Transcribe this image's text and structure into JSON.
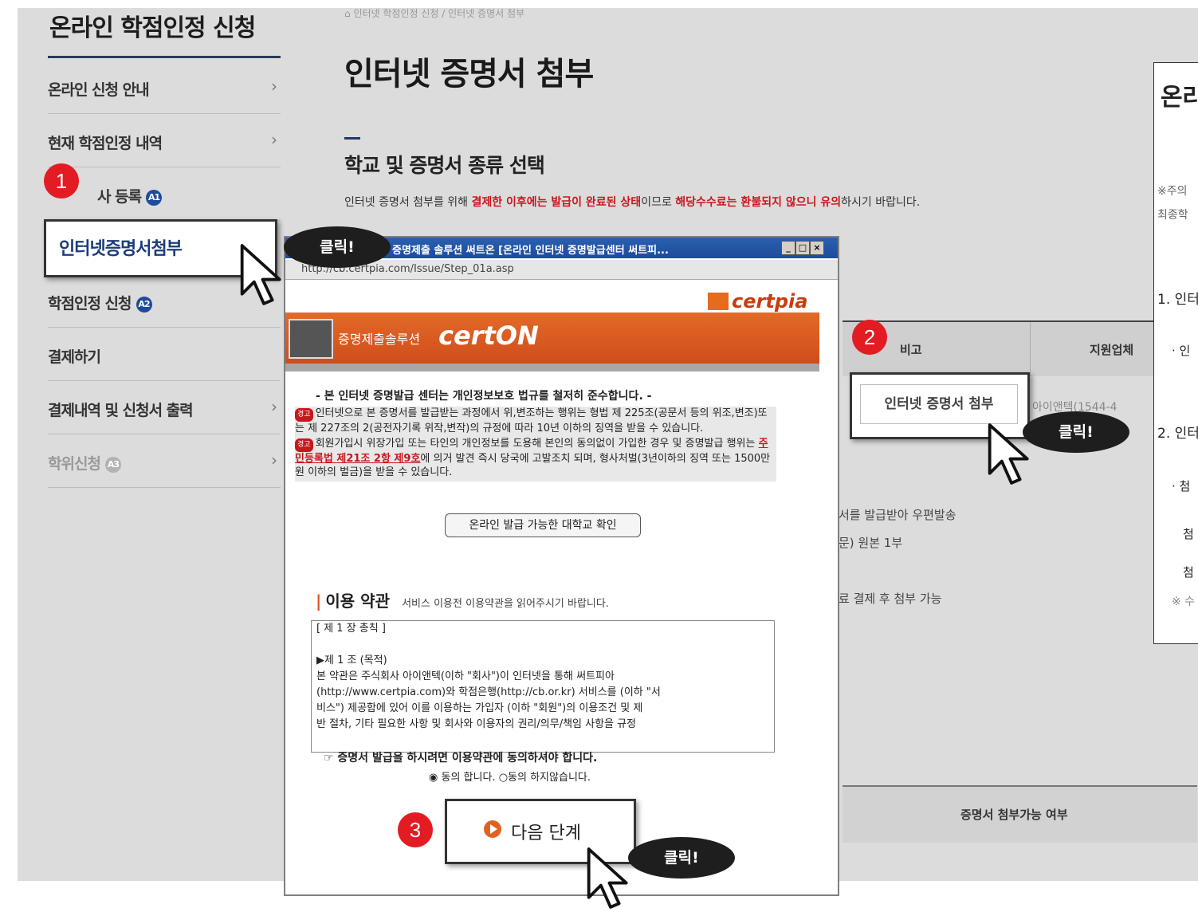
{
  "left_title": "온라인 학점인정 신청",
  "breadcrumb": "인터넷 학점인정 신청 / 인터넷 증명서 첨부",
  "nav": [
    {
      "label": "온라인 신청 안내"
    },
    {
      "label": "현재 학점인정 내역"
    },
    {
      "label": "사 등록",
      "badge": "A1"
    },
    {
      "label": "인터넷증명서첨부"
    },
    {
      "label": "학점인정 신청",
      "badge": "A2"
    },
    {
      "label": "결제하기"
    },
    {
      "label": "결제내역 및 신청서 출력"
    },
    {
      "label": "학위신청",
      "badge": "A3"
    }
  ],
  "main": {
    "title": "인터넷 증명서 첨부",
    "subtitle": "학교 및 증명서 종류 선택",
    "notice": {
      "p1": "인터넷 증명서 첨부를 위해 ",
      "r1": "결제한 이후에는 발급이 완료된 상태",
      "p2": "이므로 ",
      "r2": "해당수수료는 환불되지 않으니 유의",
      "p3": "하시기 바랍니다."
    },
    "table": {
      "col_note": "비고",
      "col_vendor": "지원업체",
      "vendor_value": "아이앤텍(1544-4",
      "attach_button": "인터넷 증명서 첨부"
    },
    "desc_lines": [
      "서를 발급받아 우편발송",
      "문) 원본 1부",
      "료 결제 후 첨부 가능"
    ],
    "bottom_header": "증명서 첨부가능 여부"
  },
  "right_panel": {
    "title": "온라",
    "note1": "※주의",
    "note2": "최종학",
    "item1": "1. 인터",
    "bullet1": "· 인",
    "item2": "2. 인터",
    "bullet2": "· 첨",
    "line1": "첨",
    "line2": "첨",
    "note3": "※ 수"
  },
  "popup": {
    "title": "증명제출 솔루션 써트온 [온라인 인터넷 증명발급센터 써트피...",
    "url": "http://cb.certpia.com/Issue/Step_01a.asp",
    "brand": "certpia",
    "banner_prefix": "증명제출솔루션",
    "banner_brand": "certON",
    "headline": "- 본 인터넷 증명발급 센터는 개인정보보호 법규를 철저히 준수합니다. -",
    "legal_tag": "경고",
    "legal1": "인터넷으로 본 증명서를 발급받는 과정에서 위,변조하는 행위는 형법 제 225조(공문서 등의 위조,변조)또는 제 227조의 2(공전자기록 위작,변작)의 규정에 따라 10년 이하의 징역을 받을 수 있습니다.",
    "legal2a": "회원가입시 위장가입 또는 타인의 개인정보를 도용해 본인의 동의없이 가입한 경우 및 증명발급 행위는 ",
    "legal2link": "주민등록법 제21조 2항 제9호",
    "legal2b": "에 의거 발견 즉시 당국에 고발조치 되며, 형사처벌(3년이하의 징역 또는 1500만원 이하의 벌금)을 받을 수 있습니다.",
    "univ_button": "온라인 발급 가능한 대학교 확인",
    "terms_title": "이용 약관",
    "terms_sub": "서비스 이용전 이용약관을 읽어주시기 바랍니다.",
    "terms_lines": [
      "[ 제 1 장 총칙 ]",
      "",
      "▶제 1 조 (목적)",
      "본 약관은 주식회사 아이앤텍(이하 \"회사\")이 인터넷을 통해 써트피아",
      "(http://www.certpia.com)와 학점은행(http://cb.or.kr) 서비스를 (이하 \"서",
      "비스\") 제공함에 있어 이를 이용하는 가입자 (이하 \"회원\")의 이용조건 및 제",
      "반 절차, 기타 필요한 사항 및 회사와 이용자의 권리/의무/책임 사항을 규정"
    ],
    "agree_notice": "☞ 증명서 발급을 하시려면 이용약관에 동의하셔야 합니다.",
    "agree_yes": "동의 합니다.",
    "agree_no": "동의 하지않습니다.",
    "next_button": "다음 단계"
  },
  "callouts": {
    "c1": "1",
    "c2": "2",
    "c3": "3",
    "click": "클릭!"
  },
  "colors": {
    "callout_red": "#e31b23",
    "nav_blue": "#1b3c7a",
    "banner_orange": "#d9561f",
    "notice_red": "#c8171d"
  }
}
